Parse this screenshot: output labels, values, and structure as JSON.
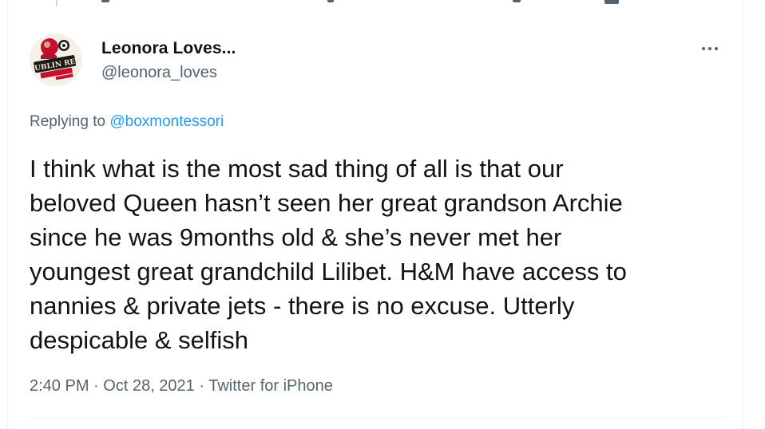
{
  "tweet": {
    "author": {
      "display_name": "Leonora Loves...",
      "handle": "@leonora_loves",
      "avatar_icon": "dublin-red-logo-avatar",
      "avatar_logo_text": "DUBLIN RED"
    },
    "replying_prefix": "Replying to",
    "replying_to": "@boxmontessori",
    "text": "I think what is the most sad thing of all is that our\nbeloved Queen hasn’t seen her great grandson Archie\nsince he was 9months old & she’s never met her\nyoungest great grandchild Lilibet. H&M have access to\nnannies & private jets - there is no excuse. Utterly\ndespicable & selfish",
    "time": "2:40 PM",
    "separator": "·",
    "date": "Oct 28, 2021",
    "source": "Twitter for iPhone"
  },
  "colors": {
    "text_primary": "#0f1419",
    "text_secondary": "#536471",
    "link": "#1d9bf0",
    "divider": "#eff3f4"
  },
  "icons": {
    "more": "more-options-icon"
  }
}
